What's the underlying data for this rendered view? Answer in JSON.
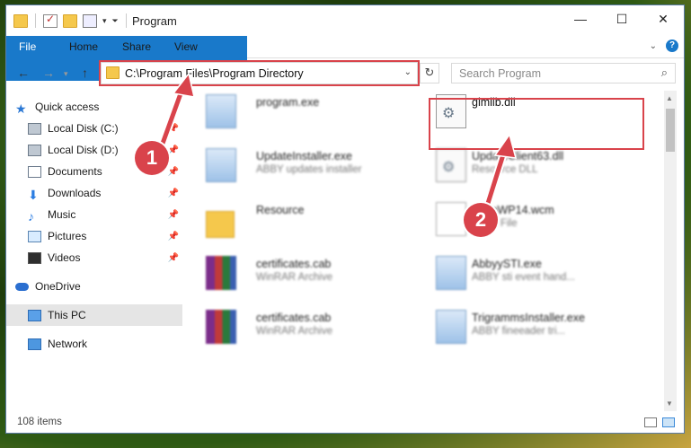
{
  "window": {
    "title": "Program"
  },
  "ribbon": {
    "tabs": [
      "File",
      "Home",
      "Share",
      "View"
    ]
  },
  "address": {
    "path": "C:\\Program Files\\Program Directory"
  },
  "search": {
    "placeholder": "Search Program"
  },
  "nav": {
    "items": [
      {
        "label": "Quick access",
        "icon": "star-icon"
      },
      {
        "label": "Local Disk (C:)",
        "icon": "disk-icon",
        "pinned": true
      },
      {
        "label": "Local Disk (D:)",
        "icon": "disk-icon",
        "pinned": true
      },
      {
        "label": "Documents",
        "icon": "documents-icon",
        "pinned": true
      },
      {
        "label": "Downloads",
        "icon": "downloads-icon",
        "pinned": true
      },
      {
        "label": "Music",
        "icon": "music-icon",
        "pinned": true
      },
      {
        "label": "Pictures",
        "icon": "pictures-icon",
        "pinned": true
      },
      {
        "label": "Videos",
        "icon": "videos-icon",
        "pinned": true
      },
      {
        "label": "OneDrive",
        "icon": "onedrive-icon"
      },
      {
        "label": "This PC",
        "icon": "pc-icon",
        "selected": true
      },
      {
        "label": "Network",
        "icon": "network-icon"
      }
    ]
  },
  "files": [
    {
      "name": "program.exe",
      "type": "",
      "kind": "exe"
    },
    {
      "name": "glmlib.dll",
      "type": "",
      "kind": "dll",
      "highlighted": true
    },
    {
      "name": "UpdateInstaller.exe",
      "type": "ABBY updates installer",
      "kind": "exe"
    },
    {
      "name": "UpdateClient63.dll",
      "type": "Resource DLL",
      "kind": "dll"
    },
    {
      "name": "Resource",
      "type": "",
      "kind": "folder"
    },
    {
      "name": "ScanWP14.wcm",
      "type": "WCM File",
      "kind": "doc"
    },
    {
      "name": "certificates.cab",
      "type": "WinRAR Archive",
      "kind": "rar"
    },
    {
      "name": "AbbyySTI.exe",
      "type": "ABBY sti event hand...",
      "kind": "exe"
    },
    {
      "name": "certificates.cab",
      "type": "WinRAR Archive",
      "kind": "rar"
    },
    {
      "name": "TrigrammsInstaller.exe",
      "type": "ABBY fineeader tri...",
      "kind": "exe"
    }
  ],
  "status": {
    "item_count": "108 items"
  },
  "callouts": [
    "1",
    "2"
  ],
  "colors": {
    "accent": "#1979ca",
    "callout": "#d9434b"
  }
}
